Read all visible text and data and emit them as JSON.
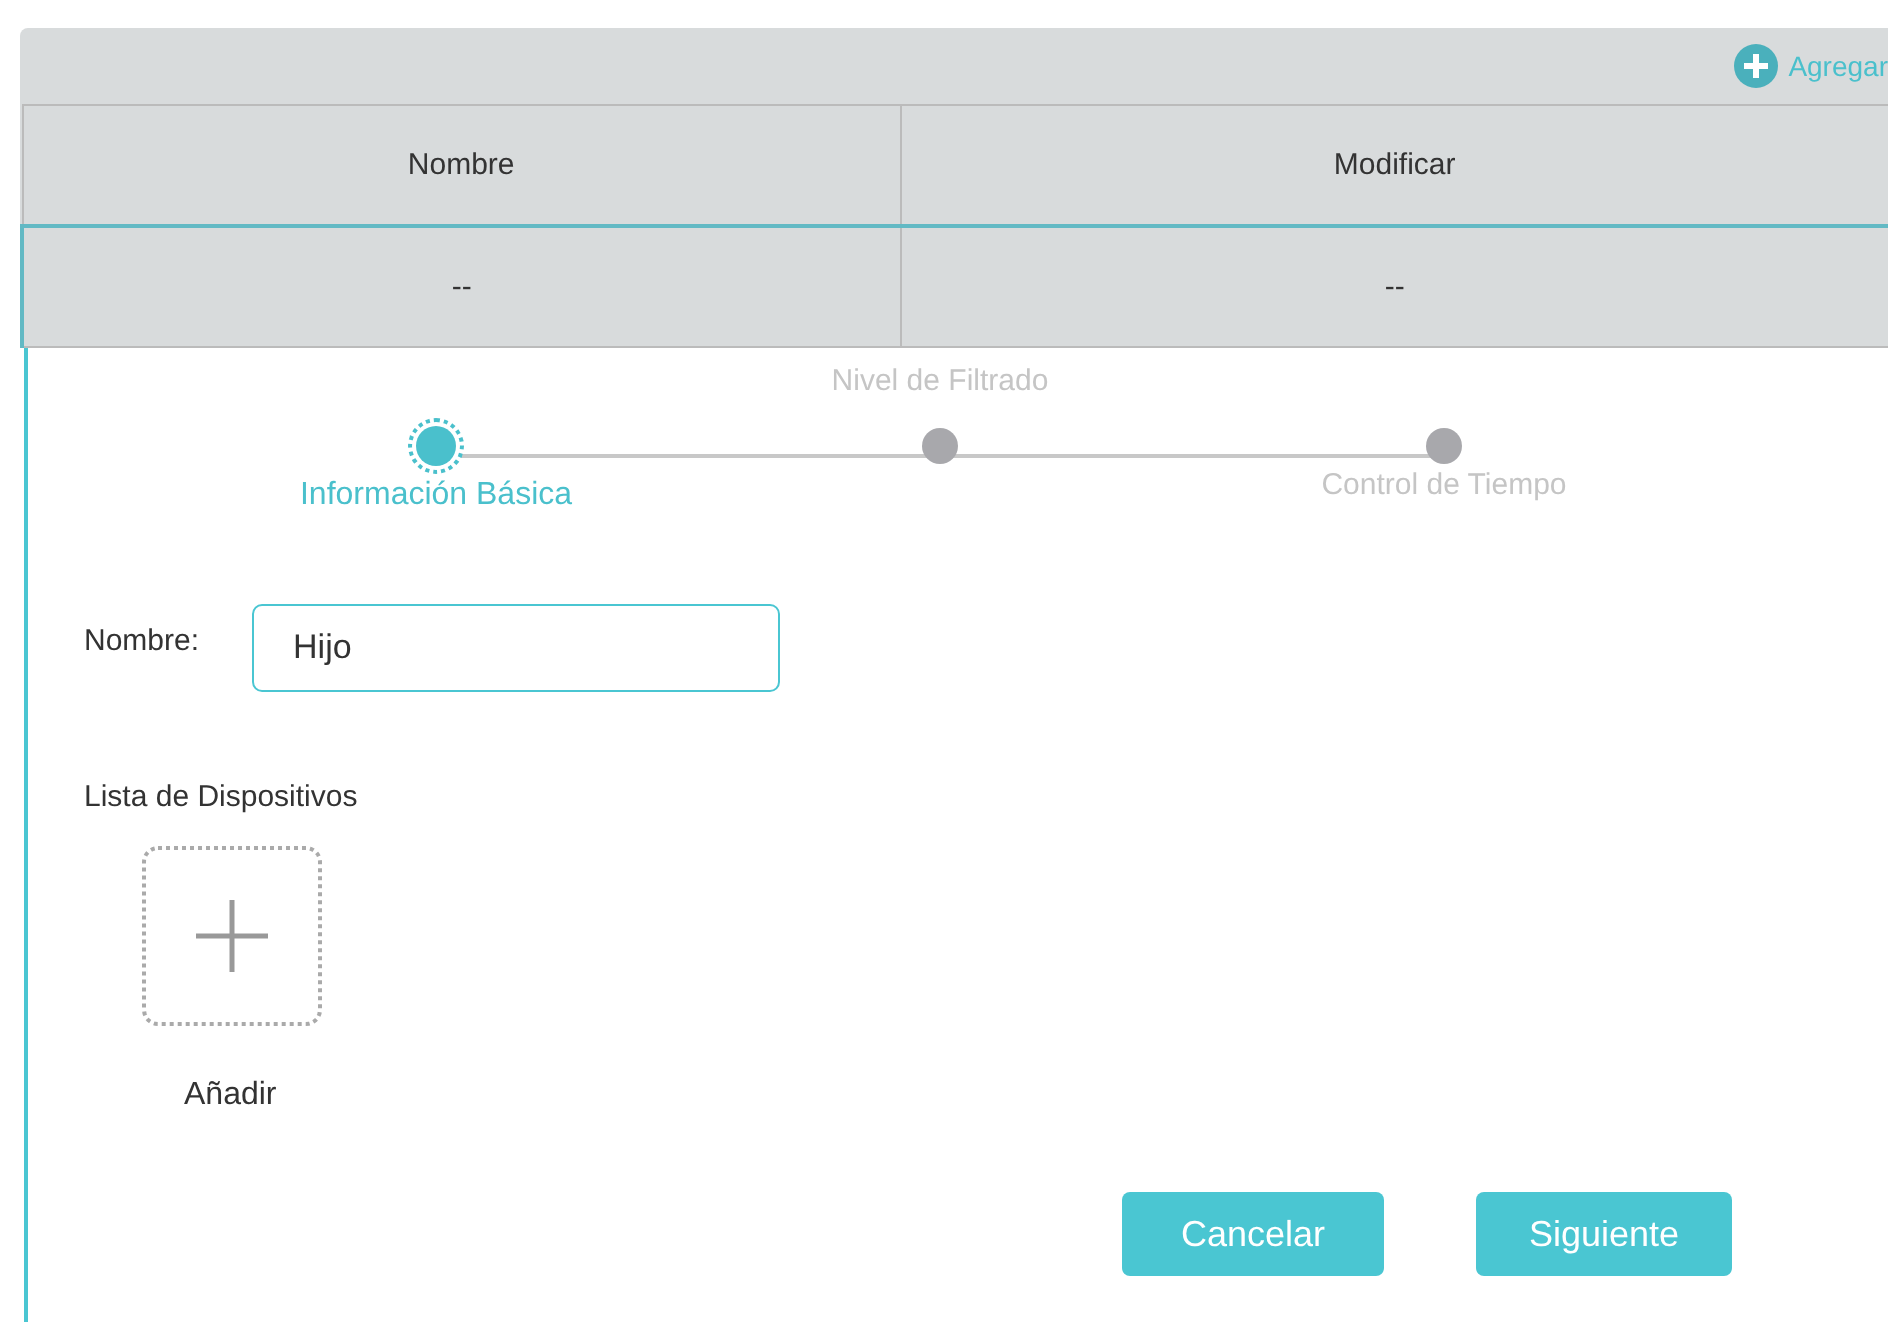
{
  "toolbar": {
    "add_label": "Agregar"
  },
  "table": {
    "columns": [
      "Nombre",
      "Modificar"
    ],
    "rows": [
      [
        "--",
        "--"
      ]
    ]
  },
  "stepper": [
    {
      "label": "Información Básica",
      "selected": true
    },
    {
      "label": "Nivel de Filtrado",
      "selected": false
    },
    {
      "label": "Control de Tiempo",
      "selected": false
    }
  ],
  "form": {
    "name_label": "Nombre:",
    "name_value": "Hijo",
    "devices_label": "Lista de Dispositivos",
    "add_device_label": "Añadir"
  },
  "buttons": [
    "Cancelar",
    "Siguiente"
  ]
}
